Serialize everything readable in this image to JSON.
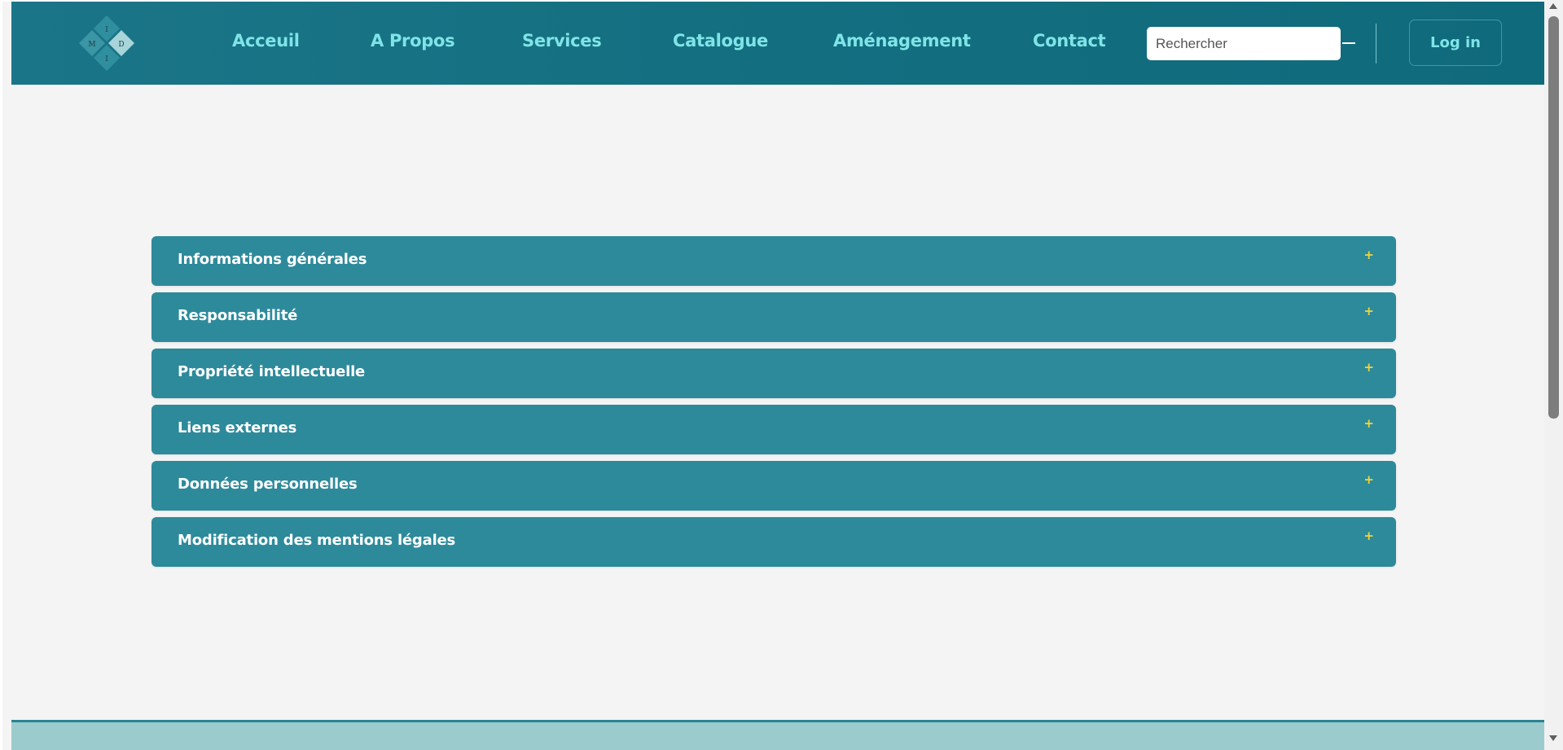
{
  "logo": {
    "letters": {
      "top": "I",
      "left": "M",
      "right": "D",
      "bottom": "I"
    }
  },
  "nav": {
    "items": [
      "Acceuil",
      "A Propos",
      "Services",
      "Catalogue",
      "Aménagement",
      "Contact"
    ]
  },
  "search": {
    "placeholder": "Rechercher",
    "value": ""
  },
  "auth": {
    "login_label": "Log in"
  },
  "accordion": {
    "items": [
      {
        "title": "Informations générales",
        "icon": "+"
      },
      {
        "title": "Responsabilité",
        "icon": "+"
      },
      {
        "title": "Propriété intellectuelle",
        "icon": "+"
      },
      {
        "title": "Liens externes",
        "icon": "+"
      },
      {
        "title": "Données personnelles",
        "icon": "+"
      },
      {
        "title": "Modification des mentions légales",
        "icon": "+"
      }
    ]
  },
  "colors": {
    "header": "#136f80",
    "nav_text": "#7fe4e7",
    "accordion_bg": "#2d8a9b",
    "accordion_icon": "#f3d43a",
    "footer": "#9ccbcd",
    "page_bg": "#f4f4f4"
  }
}
